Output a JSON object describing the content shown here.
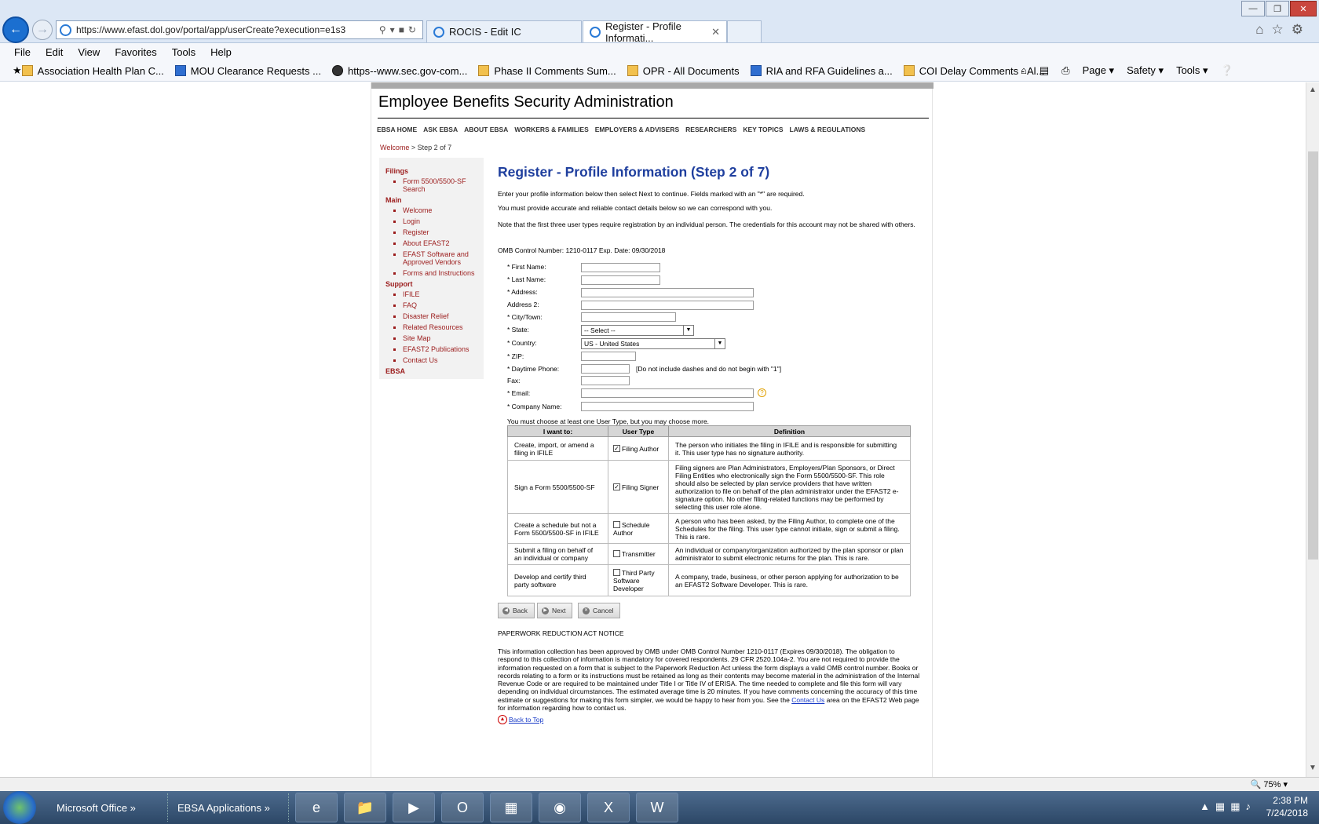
{
  "browser": {
    "address": "https://www.efast.dol.gov/portal/app/userCreate?execution=e1s3",
    "tabs": [
      {
        "label": "ROCIS - Edit IC"
      },
      {
        "label": "Register - Profile Informati..."
      }
    ],
    "menu": [
      "File",
      "Edit",
      "View",
      "Favorites",
      "Tools",
      "Help"
    ],
    "favorites": [
      "Association Health Plan C...",
      "MOU Clearance Requests ...",
      "https--www.sec.gov-com...",
      "Phase II Comments Sum...",
      "OPR - All Documents",
      "RIA and RFA Guidelines a...",
      "COI Delay Comments - Al..."
    ],
    "toolbar_right": [
      "Page ▾",
      "Safety ▾",
      "Tools ▾"
    ],
    "zoom": "75%"
  },
  "site": {
    "title": "Employee Benefits Security Administration",
    "nav": [
      "EBSA HOME",
      "ASK EBSA",
      "ABOUT EBSA",
      "WORKERS & FAMILIES",
      "EMPLOYERS & ADVISERS",
      "RESEARCHERS",
      "KEY TOPICS",
      "LAWS & REGULATIONS"
    ],
    "breadcrumb": {
      "link": "Welcome",
      "sep": ">",
      "current": "Step 2 of 7"
    }
  },
  "sidebar": {
    "filings_heading": "Filings",
    "filings": [
      "Form 5500/5500-SF Search"
    ],
    "main_heading": "Main",
    "main": [
      "Welcome",
      "Login",
      "Register",
      "About EFAST2",
      "EFAST Software and Approved Vendors",
      "Forms and Instructions"
    ],
    "support_heading": "Support",
    "support": [
      "IFILE",
      "FAQ",
      "Disaster Relief",
      "Related Resources",
      "Site Map",
      "EFAST2 Publications",
      "Contact Us"
    ],
    "ebsa_heading": "EBSA"
  },
  "form": {
    "title": "Register - Profile Information (Step 2 of 7)",
    "intro1": "Enter your profile information below then select Next to continue. Fields marked with an \"*\" are required.",
    "intro2": "You must provide accurate and reliable contact details below so we can correspond with you.",
    "intro3": "Note that the first three user types require registration by an individual person. The credentials for this account may not be shared with others.",
    "omb": "OMB Control Number: 1210-0117 Exp. Date: 09/30/2018",
    "labels": {
      "first_name": "* First Name:",
      "last_name": "* Last Name:",
      "address": "* Address:",
      "address2": "Address 2:",
      "city": "* City/Town:",
      "state": "* State:",
      "country": "* Country:",
      "zip": "* ZIP:",
      "phone": "* Daytime Phone:",
      "fax": "Fax:",
      "email": "* Email:",
      "company": "* Company Name:"
    },
    "state_value": "-- Select --",
    "country_value": "US - United States",
    "phone_hint": "[Do not include dashes and do not begin with \"1\"]",
    "user_type_note": "You must choose at least one User Type, but you may choose more.",
    "table_headers": [
      "I want to:",
      "User Type",
      "Definition"
    ],
    "user_types": [
      {
        "want": "Create, import, or amend a filing in IFILE",
        "type": "Filing Author",
        "checked": true,
        "definition": "The person who initiates the filing in IFILE and is responsible for submitting it. This user type has no signature authority."
      },
      {
        "want": "Sign a Form 5500/5500-SF",
        "type": "Filing Signer",
        "checked": true,
        "definition": "Filing signers are Plan Administrators, Employers/Plan Sponsors, or Direct Filing Entities who electronically sign the Form 5500/5500-SF. This role should also be selected by plan service providers that have written authorization to file on behalf of the plan administrator under the EFAST2 e-signature option. No other filing-related functions may be performed by selecting this user role alone."
      },
      {
        "want": "Create a schedule but not a Form 5500/5500-SF in IFILE",
        "type": "Schedule Author",
        "checked": false,
        "definition": "A person who has been asked, by the Filing Author, to complete one of the Schedules for the filing. This user type cannot initiate, sign or submit a filing. This is rare."
      },
      {
        "want": "Submit a filing on behalf of an individual or company",
        "type": "Transmitter",
        "checked": false,
        "definition": "An individual or company/organization authorized by the plan sponsor or plan administrator to submit electronic returns for the plan. This is rare."
      },
      {
        "want": "Develop and certify third party software",
        "type": "Third Party Software Developer",
        "checked": false,
        "definition": "A company, trade, business, or other person applying for authorization to be an EFAST2 Software Developer. This is rare."
      }
    ],
    "buttons": {
      "back": "Back",
      "next": "Next",
      "cancel": "Cancel"
    },
    "pra_heading": "PAPERWORK REDUCTION ACT NOTICE",
    "pra_text_1": "This information collection has been approved by OMB under OMB Control Number 1210-0117 (Expires 09/30/2018). The obligation to respond to this collection of information is mandatory for covered respondents. 29 CFR 2520.104a-2. You are not required to provide the information requested on a form that is subject to the Paperwork Reduction Act unless the form displays a valid OMB control number. Books or records relating to a form or its instructions must be retained as long as their contents may become material in the administration of the Internal Revenue Code or are required to be maintained under Title I or Title IV of ERISA. The time needed to complete and file this form will vary depending on individual circumstances. The estimated average time is 20 minutes. If you have comments concerning the accuracy of this time estimate or suggestions for making this form simpler, we would be happy to hear from you. See the",
    "pra_link": "Contact Us",
    "pra_text_2": "area on the EFAST2 Web page for information regarding how to contact us.",
    "back_to_top": "Back to Top"
  },
  "taskbar": {
    "groups": [
      "Microsoft Office",
      "EBSA Applications"
    ],
    "time": "2:38 PM",
    "date": "7/24/2018"
  }
}
